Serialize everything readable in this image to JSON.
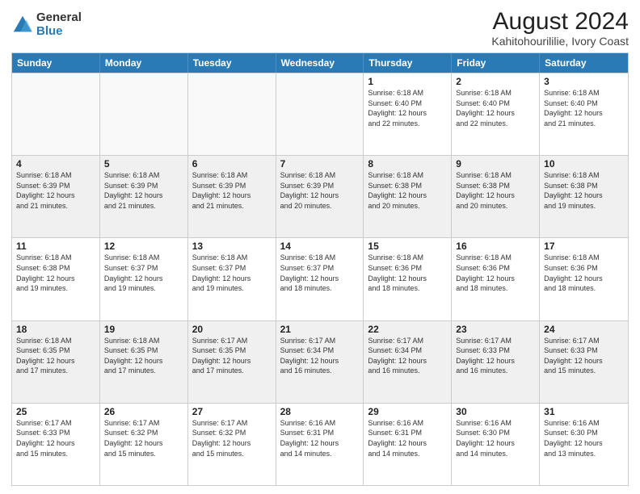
{
  "logo": {
    "general": "General",
    "blue": "Blue"
  },
  "title": "August 2024",
  "subtitle": "Kahitohourililie, Ivory Coast",
  "days": [
    "Sunday",
    "Monday",
    "Tuesday",
    "Wednesday",
    "Thursday",
    "Friday",
    "Saturday"
  ],
  "weeks": [
    [
      {
        "day": "",
        "info": ""
      },
      {
        "day": "",
        "info": ""
      },
      {
        "day": "",
        "info": ""
      },
      {
        "day": "",
        "info": ""
      },
      {
        "day": "1",
        "info": "Sunrise: 6:18 AM\nSunset: 6:40 PM\nDaylight: 12 hours\nand 22 minutes."
      },
      {
        "day": "2",
        "info": "Sunrise: 6:18 AM\nSunset: 6:40 PM\nDaylight: 12 hours\nand 22 minutes."
      },
      {
        "day": "3",
        "info": "Sunrise: 6:18 AM\nSunset: 6:40 PM\nDaylight: 12 hours\nand 21 minutes."
      }
    ],
    [
      {
        "day": "4",
        "info": "Sunrise: 6:18 AM\nSunset: 6:39 PM\nDaylight: 12 hours\nand 21 minutes."
      },
      {
        "day": "5",
        "info": "Sunrise: 6:18 AM\nSunset: 6:39 PM\nDaylight: 12 hours\nand 21 minutes."
      },
      {
        "day": "6",
        "info": "Sunrise: 6:18 AM\nSunset: 6:39 PM\nDaylight: 12 hours\nand 21 minutes."
      },
      {
        "day": "7",
        "info": "Sunrise: 6:18 AM\nSunset: 6:39 PM\nDaylight: 12 hours\nand 20 minutes."
      },
      {
        "day": "8",
        "info": "Sunrise: 6:18 AM\nSunset: 6:38 PM\nDaylight: 12 hours\nand 20 minutes."
      },
      {
        "day": "9",
        "info": "Sunrise: 6:18 AM\nSunset: 6:38 PM\nDaylight: 12 hours\nand 20 minutes."
      },
      {
        "day": "10",
        "info": "Sunrise: 6:18 AM\nSunset: 6:38 PM\nDaylight: 12 hours\nand 19 minutes."
      }
    ],
    [
      {
        "day": "11",
        "info": "Sunrise: 6:18 AM\nSunset: 6:38 PM\nDaylight: 12 hours\nand 19 minutes."
      },
      {
        "day": "12",
        "info": "Sunrise: 6:18 AM\nSunset: 6:37 PM\nDaylight: 12 hours\nand 19 minutes."
      },
      {
        "day": "13",
        "info": "Sunrise: 6:18 AM\nSunset: 6:37 PM\nDaylight: 12 hours\nand 19 minutes."
      },
      {
        "day": "14",
        "info": "Sunrise: 6:18 AM\nSunset: 6:37 PM\nDaylight: 12 hours\nand 18 minutes."
      },
      {
        "day": "15",
        "info": "Sunrise: 6:18 AM\nSunset: 6:36 PM\nDaylight: 12 hours\nand 18 minutes."
      },
      {
        "day": "16",
        "info": "Sunrise: 6:18 AM\nSunset: 6:36 PM\nDaylight: 12 hours\nand 18 minutes."
      },
      {
        "day": "17",
        "info": "Sunrise: 6:18 AM\nSunset: 6:36 PM\nDaylight: 12 hours\nand 18 minutes."
      }
    ],
    [
      {
        "day": "18",
        "info": "Sunrise: 6:18 AM\nSunset: 6:35 PM\nDaylight: 12 hours\nand 17 minutes."
      },
      {
        "day": "19",
        "info": "Sunrise: 6:18 AM\nSunset: 6:35 PM\nDaylight: 12 hours\nand 17 minutes."
      },
      {
        "day": "20",
        "info": "Sunrise: 6:17 AM\nSunset: 6:35 PM\nDaylight: 12 hours\nand 17 minutes."
      },
      {
        "day": "21",
        "info": "Sunrise: 6:17 AM\nSunset: 6:34 PM\nDaylight: 12 hours\nand 16 minutes."
      },
      {
        "day": "22",
        "info": "Sunrise: 6:17 AM\nSunset: 6:34 PM\nDaylight: 12 hours\nand 16 minutes."
      },
      {
        "day": "23",
        "info": "Sunrise: 6:17 AM\nSunset: 6:33 PM\nDaylight: 12 hours\nand 16 minutes."
      },
      {
        "day": "24",
        "info": "Sunrise: 6:17 AM\nSunset: 6:33 PM\nDaylight: 12 hours\nand 15 minutes."
      }
    ],
    [
      {
        "day": "25",
        "info": "Sunrise: 6:17 AM\nSunset: 6:33 PM\nDaylight: 12 hours\nand 15 minutes."
      },
      {
        "day": "26",
        "info": "Sunrise: 6:17 AM\nSunset: 6:32 PM\nDaylight: 12 hours\nand 15 minutes."
      },
      {
        "day": "27",
        "info": "Sunrise: 6:17 AM\nSunset: 6:32 PM\nDaylight: 12 hours\nand 15 minutes."
      },
      {
        "day": "28",
        "info": "Sunrise: 6:16 AM\nSunset: 6:31 PM\nDaylight: 12 hours\nand 14 minutes."
      },
      {
        "day": "29",
        "info": "Sunrise: 6:16 AM\nSunset: 6:31 PM\nDaylight: 12 hours\nand 14 minutes."
      },
      {
        "day": "30",
        "info": "Sunrise: 6:16 AM\nSunset: 6:30 PM\nDaylight: 12 hours\nand 14 minutes."
      },
      {
        "day": "31",
        "info": "Sunrise: 6:16 AM\nSunset: 6:30 PM\nDaylight: 12 hours\nand 13 minutes."
      }
    ]
  ]
}
